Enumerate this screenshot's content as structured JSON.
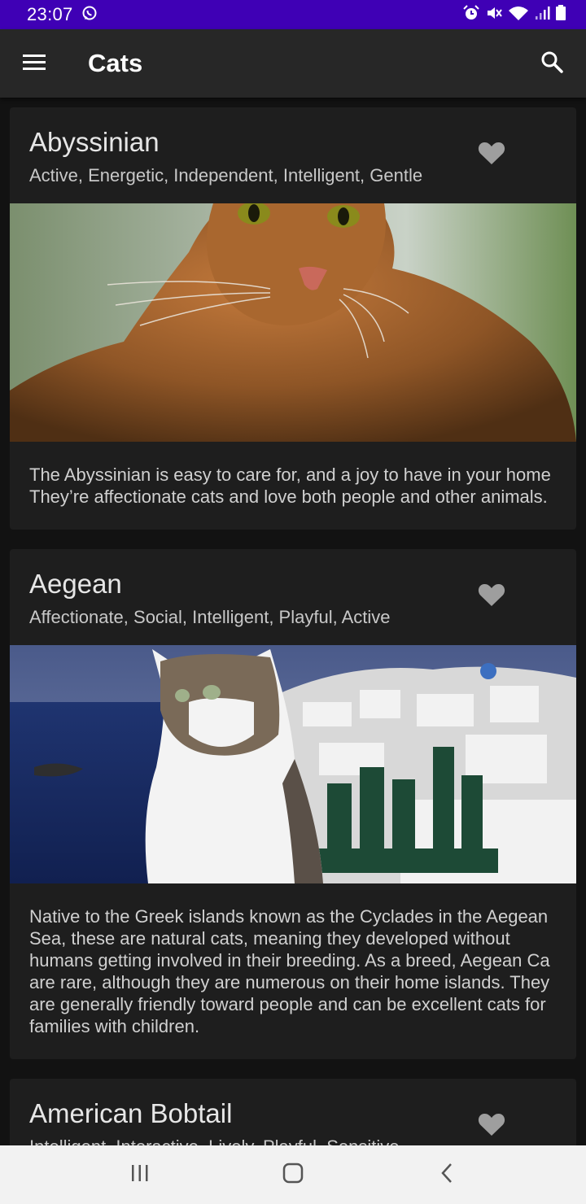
{
  "status_bar": {
    "time": "23:07",
    "icons": [
      "whatsapp-icon",
      "alarm-icon",
      "mute-icon",
      "wifi-icon",
      "signal-icon",
      "battery-icon"
    ]
  },
  "toolbar": {
    "title": "Cats",
    "menu_icon": "menu-icon",
    "search_icon": "search-icon"
  },
  "cards": [
    {
      "name": "Abyssinian",
      "traits": "Active, Energetic, Independent, Intelligent, Gentle",
      "description": "The Abyssinian is easy to care for, and a joy to have in your home\nThey’re affectionate cats and love both people and other animals.",
      "favorite_icon": "heart-icon"
    },
    {
      "name": "Aegean",
      "traits": "Affectionate, Social, Intelligent, Playful, Active",
      "description": "Native to the Greek islands known as the Cyclades in the Aegean\nSea, these are natural cats, meaning they developed without\nhumans getting involved in their breeding. As a breed, Aegean Ca\nare rare, although they are numerous on their home islands. They\nare generally friendly toward people and can be excellent cats for\nfamilies with children.",
      "favorite_icon": "heart-icon"
    },
    {
      "name": "American Bobtail",
      "traits": "Intelligent, Interactive, Lively, Playful, Sensitive",
      "favorite_icon": "heart-icon"
    }
  ],
  "nav_bar": {
    "icons": [
      "recent-apps-icon",
      "home-icon",
      "back-icon"
    ]
  }
}
